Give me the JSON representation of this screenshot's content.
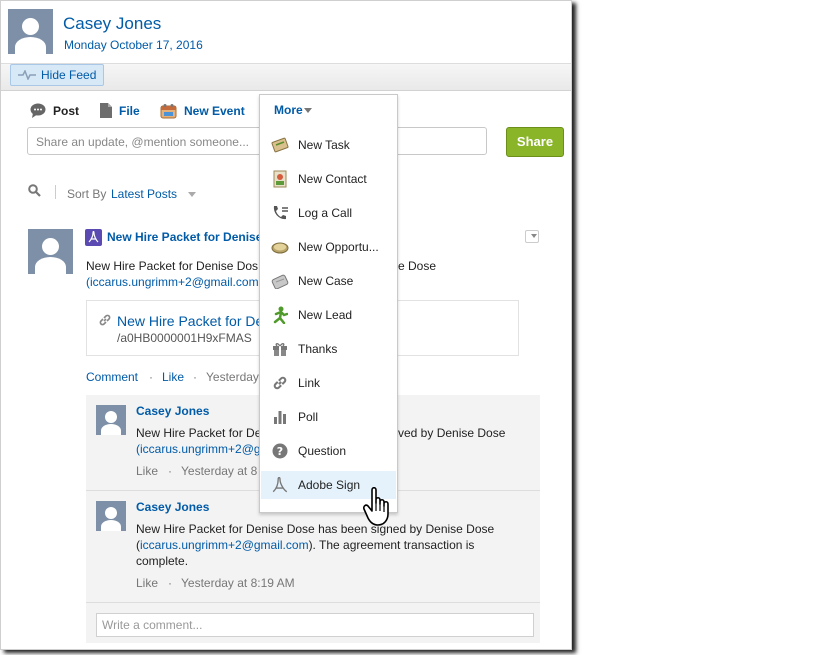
{
  "header": {
    "user_name": "Casey Jones",
    "date": "Monday October 17, 2016",
    "hide_feed_label": "Hide Feed"
  },
  "publisher": {
    "tabs": [
      {
        "label": "Post",
        "icon": "speech-bubble-icon"
      },
      {
        "label": "File",
        "icon": "document-icon"
      },
      {
        "label": "New Event",
        "icon": "calendar-icon"
      },
      {
        "label": "More",
        "icon": "chevron-down-icon"
      }
    ],
    "input_placeholder": "Share an update, @mention someone...",
    "share_label": "Share"
  },
  "sort": {
    "prefix": "Sort By",
    "value": "Latest Posts"
  },
  "feed_item": {
    "title": "New Hire Packet for Denise",
    "body_line1_left": "New Hire Packet for Denise Dos",
    "body_line1_right": "e Dose",
    "email": "(iccarus.ungrimm+2@gmail.com",
    "attachment_title": "New Hire Packet for Den",
    "attachment_id": "/a0HB0000001H9xFMAS",
    "actions": {
      "comment": "Comment",
      "like": "Like",
      "time": "Yesterday"
    }
  },
  "comments": [
    {
      "author": "Casey Jones",
      "text_left": "New Hire Packet for De",
      "text_right": "ved by Denise Dose",
      "email_partial": "(iccarus.ungrimm+2@g",
      "like": "Like",
      "time": "Yesterday at 8"
    },
    {
      "author": "Casey Jones",
      "line1": "New Hire Packet for Denise Dose has been signed by Denise Dose",
      "line2_email": "iccarus.ungrimm+2@gmail.com",
      "line2_rest": "). The agreement transaction is",
      "line3": "complete.",
      "like": "Like",
      "time": "Yesterday at 8:19 AM"
    }
  ],
  "comment_placeholder": "Write a comment...",
  "more_menu": {
    "label": "More",
    "items": [
      {
        "label": "New Task",
        "icon": "task-icon"
      },
      {
        "label": "New Contact",
        "icon": "contact-icon"
      },
      {
        "label": "Log a Call",
        "icon": "phone-icon"
      },
      {
        "label": "New Opportu...",
        "icon": "opportunity-icon"
      },
      {
        "label": "New Case",
        "icon": "case-icon"
      },
      {
        "label": "New Lead",
        "icon": "lead-icon"
      },
      {
        "label": "Thanks",
        "icon": "gift-icon"
      },
      {
        "label": "Link",
        "icon": "link-icon"
      },
      {
        "label": "Poll",
        "icon": "bar-chart-icon"
      },
      {
        "label": "Question",
        "icon": "question-icon"
      },
      {
        "label": "Adobe Sign",
        "icon": "adobe-sign-icon"
      }
    ],
    "highlighted": "Adobe Sign"
  },
  "colors": {
    "link": "#015ba7",
    "share_button": "#8ab529",
    "avatar": "#7d90a8",
    "highlight": "#e6f2fb"
  }
}
